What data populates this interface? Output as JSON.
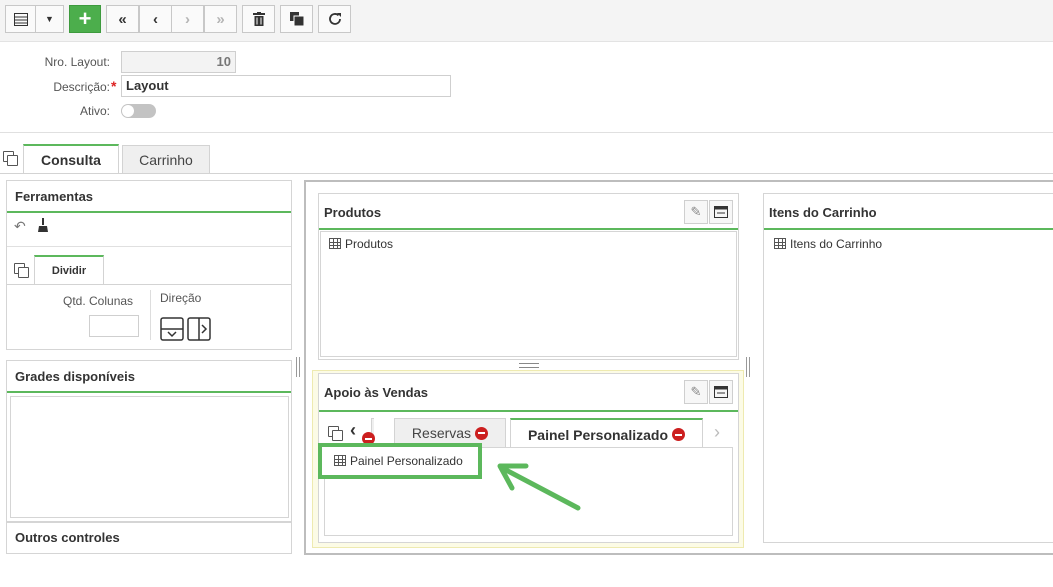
{
  "form": {
    "nro_label": "Nro. Layout:",
    "nro_value": "10",
    "descricao_label": "Descrição:",
    "descricao_value": "Layout",
    "ativo_label": "Ativo:"
  },
  "tabs": [
    {
      "label": "Consulta",
      "active": true
    },
    {
      "label": "Carrinho",
      "active": false
    }
  ],
  "tools_panel": {
    "title": "Ferramentas",
    "subtab": "Dividir",
    "qtd_label": "Qtd. Colunas",
    "direcao_label": "Direção"
  },
  "grades_panel": {
    "title": "Grades disponíveis"
  },
  "outros_panel": {
    "title": "Outros controles"
  },
  "produtos_panel": {
    "title": "Produtos",
    "item": "Produtos"
  },
  "itens_panel": {
    "title": "Itens do Carrinho",
    "item": "Itens do Carrinho"
  },
  "apoio_panel": {
    "title": "Apoio às Vendas",
    "tabs": [
      {
        "label": "Reservas",
        "active": false
      },
      {
        "label": "Painel Personalizado",
        "active": true
      }
    ],
    "content_item": "Painel Personalizado"
  },
  "colors": {
    "accent": "#5cb85c",
    "highlight": "#5cb85c",
    "danger": "#cc1f1f"
  }
}
